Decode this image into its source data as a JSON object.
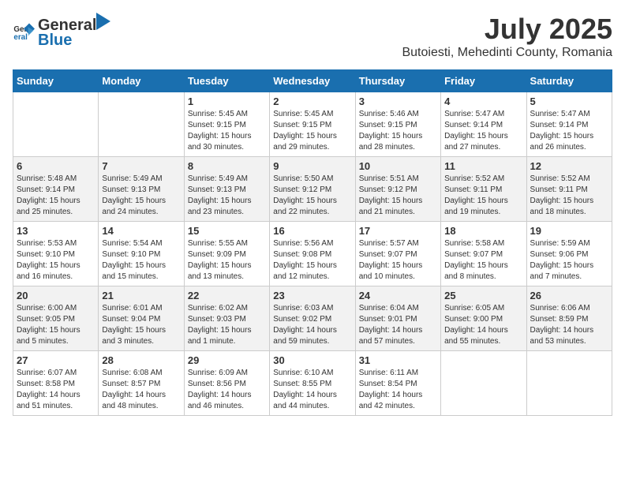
{
  "header": {
    "logo_general": "General",
    "logo_blue": "Blue",
    "main_title": "July 2025",
    "subtitle": "Butoiesti, Mehedinti County, Romania"
  },
  "weekdays": [
    "Sunday",
    "Monday",
    "Tuesday",
    "Wednesday",
    "Thursday",
    "Friday",
    "Saturday"
  ],
  "weeks": [
    [
      {
        "day": "",
        "info": ""
      },
      {
        "day": "",
        "info": ""
      },
      {
        "day": "1",
        "info": "Sunrise: 5:45 AM\nSunset: 9:15 PM\nDaylight: 15 hours\nand 30 minutes."
      },
      {
        "day": "2",
        "info": "Sunrise: 5:45 AM\nSunset: 9:15 PM\nDaylight: 15 hours\nand 29 minutes."
      },
      {
        "day": "3",
        "info": "Sunrise: 5:46 AM\nSunset: 9:15 PM\nDaylight: 15 hours\nand 28 minutes."
      },
      {
        "day": "4",
        "info": "Sunrise: 5:47 AM\nSunset: 9:14 PM\nDaylight: 15 hours\nand 27 minutes."
      },
      {
        "day": "5",
        "info": "Sunrise: 5:47 AM\nSunset: 9:14 PM\nDaylight: 15 hours\nand 26 minutes."
      }
    ],
    [
      {
        "day": "6",
        "info": "Sunrise: 5:48 AM\nSunset: 9:14 PM\nDaylight: 15 hours\nand 25 minutes."
      },
      {
        "day": "7",
        "info": "Sunrise: 5:49 AM\nSunset: 9:13 PM\nDaylight: 15 hours\nand 24 minutes."
      },
      {
        "day": "8",
        "info": "Sunrise: 5:49 AM\nSunset: 9:13 PM\nDaylight: 15 hours\nand 23 minutes."
      },
      {
        "day": "9",
        "info": "Sunrise: 5:50 AM\nSunset: 9:12 PM\nDaylight: 15 hours\nand 22 minutes."
      },
      {
        "day": "10",
        "info": "Sunrise: 5:51 AM\nSunset: 9:12 PM\nDaylight: 15 hours\nand 21 minutes."
      },
      {
        "day": "11",
        "info": "Sunrise: 5:52 AM\nSunset: 9:11 PM\nDaylight: 15 hours\nand 19 minutes."
      },
      {
        "day": "12",
        "info": "Sunrise: 5:52 AM\nSunset: 9:11 PM\nDaylight: 15 hours\nand 18 minutes."
      }
    ],
    [
      {
        "day": "13",
        "info": "Sunrise: 5:53 AM\nSunset: 9:10 PM\nDaylight: 15 hours\nand 16 minutes."
      },
      {
        "day": "14",
        "info": "Sunrise: 5:54 AM\nSunset: 9:10 PM\nDaylight: 15 hours\nand 15 minutes."
      },
      {
        "day": "15",
        "info": "Sunrise: 5:55 AM\nSunset: 9:09 PM\nDaylight: 15 hours\nand 13 minutes."
      },
      {
        "day": "16",
        "info": "Sunrise: 5:56 AM\nSunset: 9:08 PM\nDaylight: 15 hours\nand 12 minutes."
      },
      {
        "day": "17",
        "info": "Sunrise: 5:57 AM\nSunset: 9:07 PM\nDaylight: 15 hours\nand 10 minutes."
      },
      {
        "day": "18",
        "info": "Sunrise: 5:58 AM\nSunset: 9:07 PM\nDaylight: 15 hours\nand 8 minutes."
      },
      {
        "day": "19",
        "info": "Sunrise: 5:59 AM\nSunset: 9:06 PM\nDaylight: 15 hours\nand 7 minutes."
      }
    ],
    [
      {
        "day": "20",
        "info": "Sunrise: 6:00 AM\nSunset: 9:05 PM\nDaylight: 15 hours\nand 5 minutes."
      },
      {
        "day": "21",
        "info": "Sunrise: 6:01 AM\nSunset: 9:04 PM\nDaylight: 15 hours\nand 3 minutes."
      },
      {
        "day": "22",
        "info": "Sunrise: 6:02 AM\nSunset: 9:03 PM\nDaylight: 15 hours\nand 1 minute."
      },
      {
        "day": "23",
        "info": "Sunrise: 6:03 AM\nSunset: 9:02 PM\nDaylight: 14 hours\nand 59 minutes."
      },
      {
        "day": "24",
        "info": "Sunrise: 6:04 AM\nSunset: 9:01 PM\nDaylight: 14 hours\nand 57 minutes."
      },
      {
        "day": "25",
        "info": "Sunrise: 6:05 AM\nSunset: 9:00 PM\nDaylight: 14 hours\nand 55 minutes."
      },
      {
        "day": "26",
        "info": "Sunrise: 6:06 AM\nSunset: 8:59 PM\nDaylight: 14 hours\nand 53 minutes."
      }
    ],
    [
      {
        "day": "27",
        "info": "Sunrise: 6:07 AM\nSunset: 8:58 PM\nDaylight: 14 hours\nand 51 minutes."
      },
      {
        "day": "28",
        "info": "Sunrise: 6:08 AM\nSunset: 8:57 PM\nDaylight: 14 hours\nand 48 minutes."
      },
      {
        "day": "29",
        "info": "Sunrise: 6:09 AM\nSunset: 8:56 PM\nDaylight: 14 hours\nand 46 minutes."
      },
      {
        "day": "30",
        "info": "Sunrise: 6:10 AM\nSunset: 8:55 PM\nDaylight: 14 hours\nand 44 minutes."
      },
      {
        "day": "31",
        "info": "Sunrise: 6:11 AM\nSunset: 8:54 PM\nDaylight: 14 hours\nand 42 minutes."
      },
      {
        "day": "",
        "info": ""
      },
      {
        "day": "",
        "info": ""
      }
    ]
  ]
}
